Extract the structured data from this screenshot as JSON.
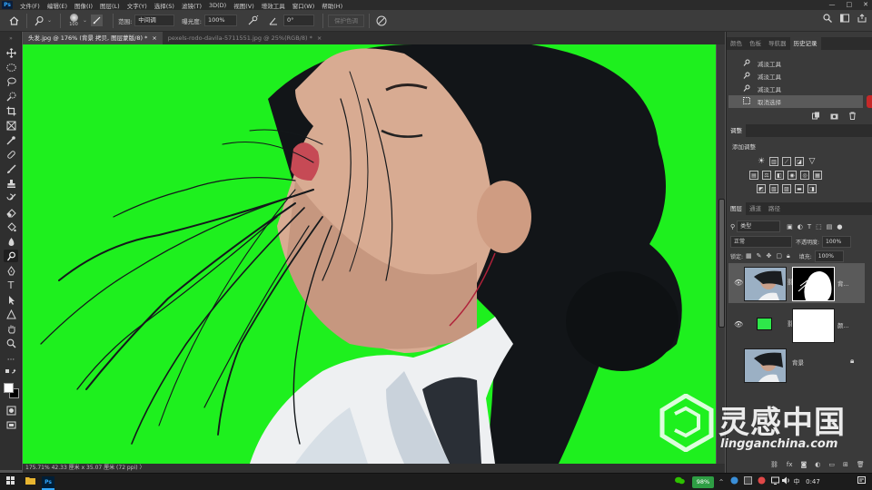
{
  "menubar": {
    "logo": "Ps",
    "items": [
      "文件(F)",
      "编辑(E)",
      "图像(I)",
      "图层(L)",
      "文字(Y)",
      "选择(S)",
      "滤镜(T)",
      "3D(D)",
      "视图(V)",
      "增效工具",
      "窗口(W)",
      "帮助(H)"
    ],
    "window_controls": [
      "—",
      "□",
      "✕"
    ]
  },
  "options": {
    "brush_size": "100",
    "range_label": "范围:",
    "range_value": "中间调",
    "exposure_label": "曝光度:",
    "exposure_value": "100%",
    "angle_value": "0°",
    "protect_tone": "保护色调"
  },
  "documents": {
    "tabs": [
      {
        "label": "头发.jpg @ 176% (背景 拷贝, 图层蒙版/8) *",
        "close": "×"
      },
      {
        "label": "pexels-rodo-davila-5711551.jpg @ 25%(RGB/8) *",
        "close": "×"
      }
    ]
  },
  "status": {
    "text": "175.71%  42.33 厘米 x 35.07 厘米 (72 ppi)  〉"
  },
  "history_panel": {
    "tabs": [
      "颜色",
      "色板",
      "导航器",
      "历史记录"
    ],
    "active_tab": "历史记录",
    "items": [
      {
        "icon": "dodge-tool-icon",
        "label": "减淡工具"
      },
      {
        "icon": "dodge-tool-icon",
        "label": "减淡工具"
      },
      {
        "icon": "dodge-tool-icon",
        "label": "减淡工具"
      },
      {
        "icon": "deselect-icon",
        "label": "取消选择"
      }
    ]
  },
  "adjustments_panel": {
    "tab": "调整",
    "heading": "添加调整"
  },
  "layers_panel": {
    "tabs": [
      "图层",
      "通道",
      "路径"
    ],
    "filter_kind": "类型",
    "blend_mode": "正常",
    "opacity_label": "不透明度:",
    "opacity_value": "100%",
    "lock_label": "锁定:",
    "fill_label": "填充:",
    "fill_value": "100%",
    "layers": [
      {
        "name": "背...",
        "selected": true
      },
      {
        "name": "颜...",
        "selected": false
      },
      {
        "name": "背景",
        "selected": false
      }
    ],
    "fill_color": "#2ee84a"
  },
  "taskbar": {
    "battery": "98%",
    "ime": "中",
    "clock": "0:47"
  },
  "watermark": {
    "title": "灵感中国",
    "url": "lingganchina.com"
  },
  "colors": {
    "canvas_green": "#1ef01e",
    "panel_bg": "#3a3a3a",
    "accent": "#31a8ff"
  }
}
